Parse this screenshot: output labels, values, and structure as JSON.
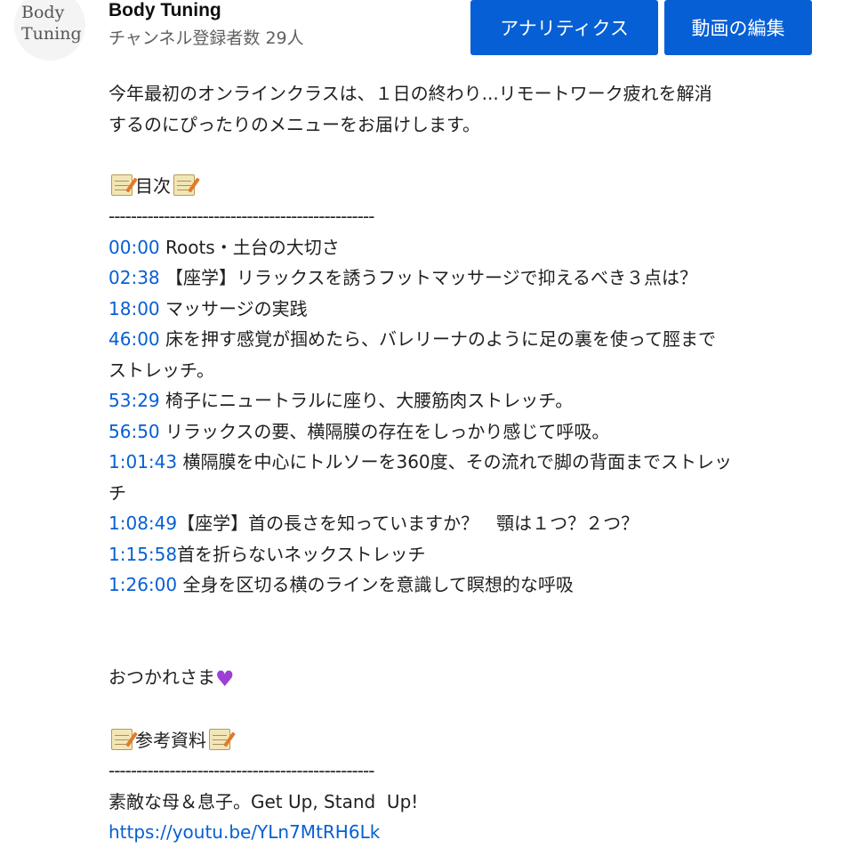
{
  "channel": {
    "logo_text": "Body\nTuning.",
    "name": "Body Tuning",
    "subscribers": "チャンネル登録者数 29人"
  },
  "actions": {
    "analytics_label": "アナリティクス",
    "edit_video_label": "動画の編集"
  },
  "description": {
    "intro_line1": "今年最初のオンラインクラスは、１日の終わり...リモートワーク疲れを解消",
    "intro_line2": "するのにぴったりのメニューをお届けします。",
    "toc_heading": "目次",
    "divider": "------------------------------------------------",
    "chapters": [
      {
        "time": "00:00",
        "title": " Roots・土台の大切さ"
      },
      {
        "time": "02:38",
        "title": " 【座学】リラックスを誘うフットマッサージで抑えるべき３点は？"
      },
      {
        "time": "18:00",
        "title": " マッサージの実践"
      },
      {
        "time": "46:00",
        "title": " 床を押す感覚が掴めたら、バレリーナのように足の裏を使って脛まで\nストレッチ。"
      },
      {
        "time": "53:29",
        "title": " 椅子にニュートラルに座り、大腰筋肉ストレッチ。"
      },
      {
        "time": "56:50",
        "title": " リラックスの要、横隔膜の存在をしっかり感じて呼吸。"
      },
      {
        "time": "1:01:43",
        "title": " 横隔膜を中心にトルソーを360度、その流れで脚の背面までストレッ\nチ"
      },
      {
        "time": "1:08:49",
        "title": "【座学】首の長さを知っていますか？　顎は１つ？２つ？"
      },
      {
        "time": "1:15:58",
        "title": "首を折らないネックストレッチ"
      },
      {
        "time": "1:26:00",
        "title": " 全身を区切る横のラインを意識して瞑想的な呼吸"
      }
    ],
    "closing": "おつかれさま",
    "references_heading": "参考資料",
    "reference_title": "素敵な母＆息子。Get Up, Stand  Up!",
    "reference_url": "https://youtu.be/YLn7MtRH6Lk"
  },
  "icons": {
    "memo": "memo-icon",
    "heart": "purple-heart-icon"
  },
  "colors": {
    "accent": "#065fd4",
    "heart": "#9b3fd6"
  }
}
